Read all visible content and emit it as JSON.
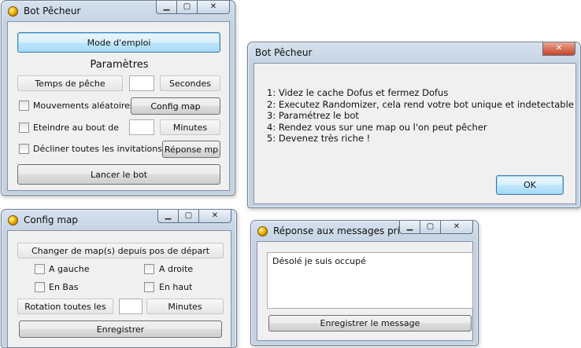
{
  "bot": {
    "title": "Bot Pêcheur",
    "mode_emploi": "Mode d'emploi",
    "parametres": "Paramètres",
    "temps_peche": "Temps de pêche",
    "temps_value": "",
    "secondes": "Secondes",
    "mouvements": "Mouvements aléatoires",
    "config_map": "Config map",
    "eteindre": "Eteindre au bout de",
    "eteindre_value": "",
    "minutes": "Minutes",
    "decliner": "Décliner toutes les invitations",
    "reponse_mp": "Réponse mp",
    "lancer": "Lancer le bot"
  },
  "dialog": {
    "title": "Bot Pêcheur",
    "lines": [
      "1: Videz le cache Dofus et fermez Dofus",
      "2: Executez Randomizer, cela rend votre bot unique et indetectable",
      "3: Paramétrez le bot",
      "4: Rendez vous sur une map ou l'on peut pêcher",
      "5: Devenez très riche !"
    ],
    "ok": "OK"
  },
  "config": {
    "title": "Config map",
    "changer": "Changer de map(s) depuis pos de départ",
    "gauche": "A gauche",
    "droite": "A droite",
    "bas": "En Bas",
    "haut": "En haut",
    "rotation": "Rotation toutes les",
    "rotation_value": "",
    "minutes": "Minutes",
    "enregistrer": "Enregistrer"
  },
  "reponse": {
    "title": "Réponse aux messages privés",
    "message": "Désolé je suis occupé",
    "enregistrer": "Enregistrer le message"
  },
  "colors": {
    "close_red": "#c7452a",
    "focus_blue": "#3c7fb1"
  }
}
